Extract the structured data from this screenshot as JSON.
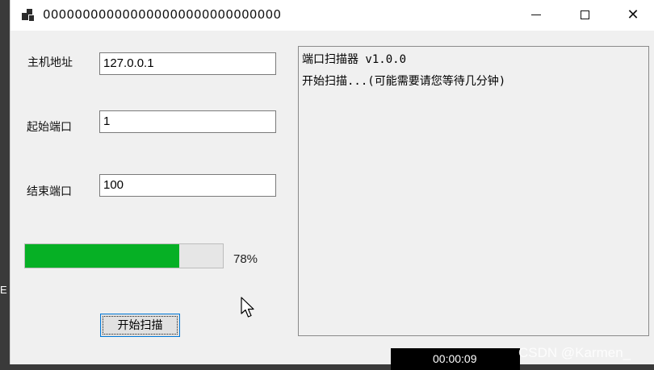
{
  "window": {
    "title": "000000000000000000000000000000",
    "icon": "app-icon",
    "controls": {
      "minimize": "minimize-icon",
      "maximize": "maximize-icon",
      "close": "✕"
    }
  },
  "form": {
    "host_label": "主机地址",
    "host_value": "127.0.0.1",
    "start_port_label": "起始端口",
    "start_port_value": "1",
    "end_port_label": "结束端口",
    "end_port_value": "100"
  },
  "progress": {
    "value": 78,
    "text": "78%",
    "color": "#06b025"
  },
  "start_button_label": "开始扫描",
  "log": {
    "lines": [
      "端口扫描器 v1.0.0",
      "开始扫描...(可能需要请您等待几分钟)"
    ]
  },
  "overlay": {
    "edge_char": "E",
    "timer": "00:00:09",
    "watermark": "CSDN @Karmen_"
  }
}
